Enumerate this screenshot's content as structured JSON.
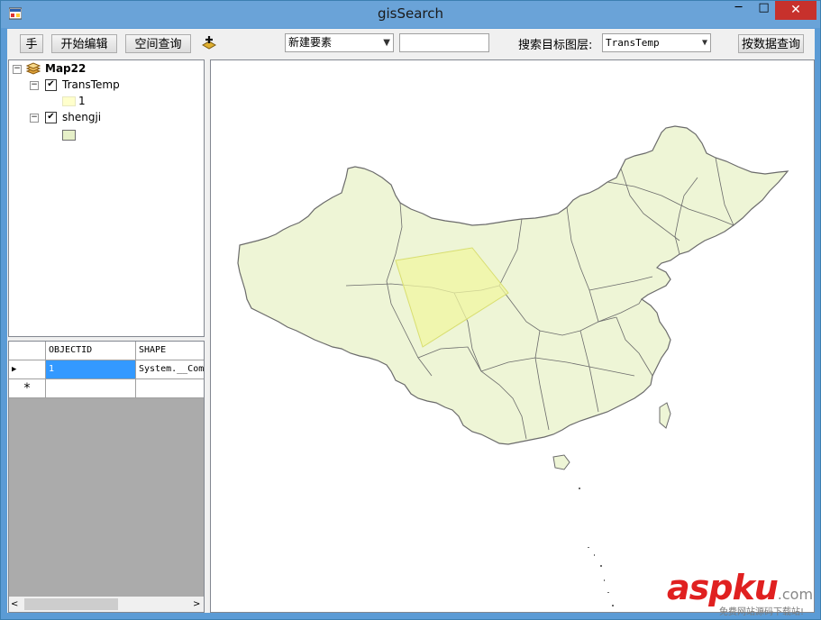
{
  "window": {
    "title": "gisSearch",
    "minimize_glyph": "─",
    "maximize_glyph": "□",
    "close_glyph": "✕"
  },
  "toolbar": {
    "hand_label": "手",
    "start_edit_label": "开始编辑",
    "spatial_query_label": "空间查询",
    "add_data_icon": "add-data-icon",
    "feature_combo_value": "新建要素",
    "search_input_value": "",
    "target_layer_label": "搜索目标图层:",
    "target_layer_value": "TransTemp",
    "attribute_query_label": "按数据查询"
  },
  "toc": {
    "map_name": "Map22",
    "layers": [
      {
        "name": "TransTemp",
        "checked": true,
        "legend_label": "1",
        "legend_color": "#ffffcc"
      },
      {
        "name": "shengji",
        "checked": true,
        "legend_label": "",
        "legend_color": "#e6f0c8"
      }
    ]
  },
  "grid": {
    "columns": [
      "OBJECTID",
      "SHAPE"
    ],
    "rows": [
      [
        "1",
        "System.__ComObject"
      ]
    ],
    "new_row_glyph": "*",
    "current_row_glyph": "▶"
  },
  "map": {
    "province_fill": "#eef5d6",
    "province_stroke": "#6b6b6b",
    "selection_fill": "#f0f5a0"
  },
  "watermark": {
    "brand": "aspku",
    "domain": ".com",
    "tagline": "免费网站源码下载站!"
  }
}
